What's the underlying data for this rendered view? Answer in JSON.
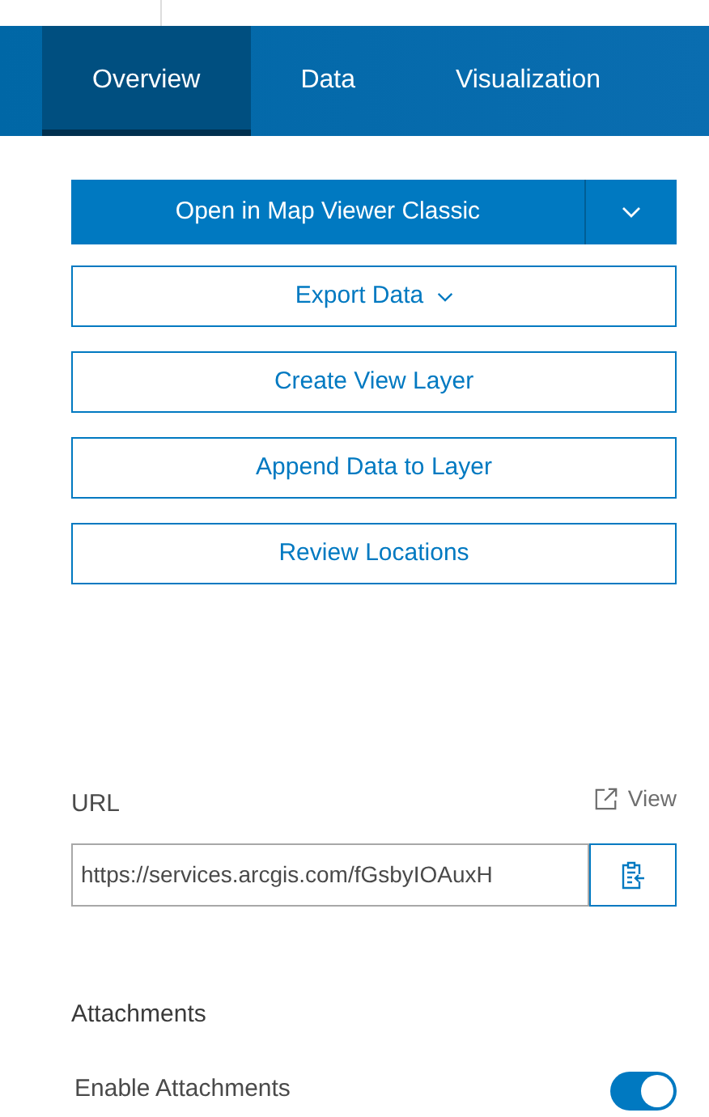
{
  "tabs": [
    {
      "label": "Overview",
      "selected": true
    },
    {
      "label": "Data",
      "selected": false
    },
    {
      "label": "Visualization",
      "selected": false
    }
  ],
  "primary_action": {
    "label": "Open in Map Viewer Classic"
  },
  "actions": [
    {
      "label": "Export Data",
      "dropdown": true
    },
    {
      "label": "Create View Layer",
      "dropdown": false
    },
    {
      "label": "Append Data to Layer",
      "dropdown": false
    },
    {
      "label": "Review Locations",
      "dropdown": false
    }
  ],
  "url": {
    "label": "URL",
    "view_link": "View",
    "value": "https://services.arcgis.com/fGsbyIOAuxH"
  },
  "attachments": {
    "title": "Attachments",
    "label": "Enable Attachments",
    "on": true
  }
}
